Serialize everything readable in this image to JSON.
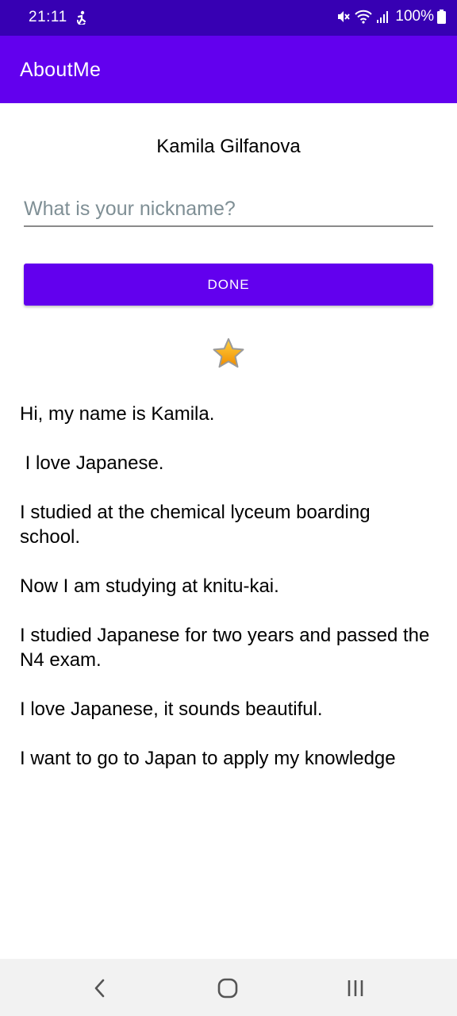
{
  "status_bar": {
    "time": "21:11",
    "battery": "100%",
    "icons": [
      "accessibility-icon",
      "mute-icon",
      "wifi-icon",
      "signal-icon",
      "battery-icon"
    ]
  },
  "app_bar": {
    "title": "AboutMe"
  },
  "content": {
    "name": "Kamila Gilfanova",
    "nickname_input": {
      "value": "",
      "placeholder": "What is your nickname?"
    },
    "done_label": "DONE",
    "star_icon": "star-icon",
    "bio": "Hi, my name is Kamila.\n\n I love Japanese.\n\nI studied at the chemical lyceum boarding school.\n\nNow I am studying at knitu-kai.\n\nI studied Japanese for two years and passed the N4 exam.\n\nI love Japanese, it sounds beautiful.\n\nI want to go to Japan to apply my knowledge"
  },
  "nav_bar": {
    "icons": [
      "back-icon",
      "home-icon",
      "recents-icon"
    ]
  },
  "colors": {
    "status_bar": "#3700b3",
    "primary": "#6200ee",
    "placeholder": "#7f8f95",
    "nav_bar": "#f2f2f2"
  }
}
